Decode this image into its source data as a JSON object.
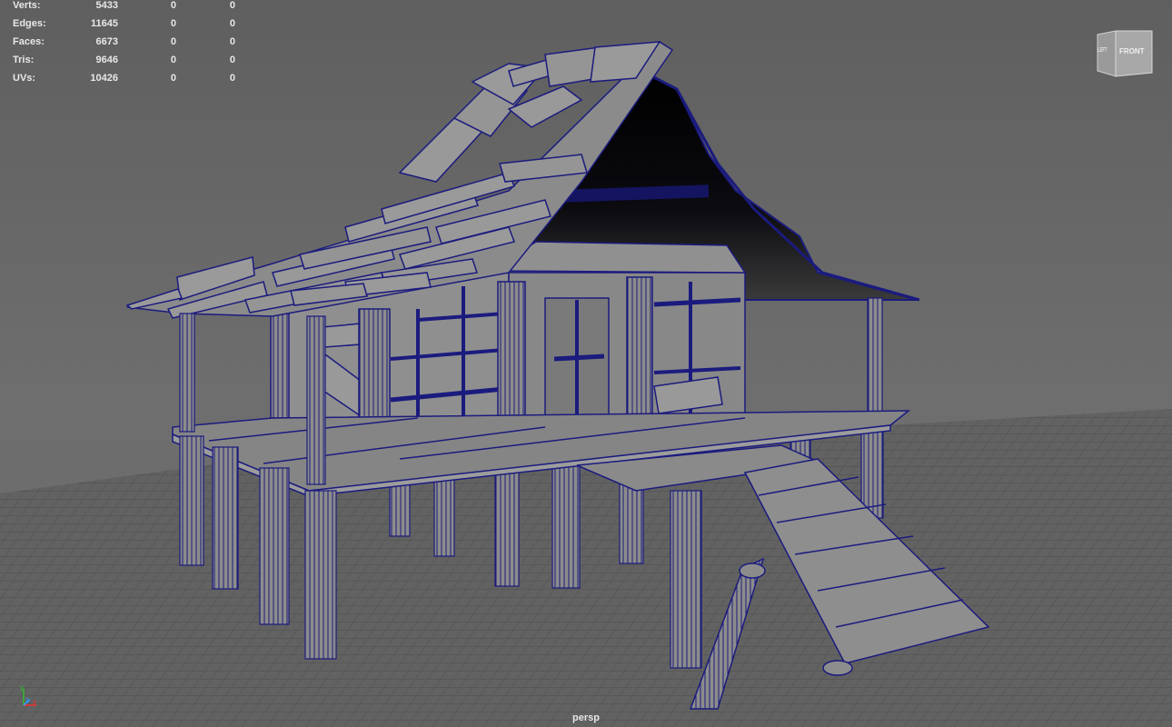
{
  "hud": {
    "rows": [
      {
        "label": "Verts:",
        "v1": "5433",
        "v2": "0",
        "v3": "0"
      },
      {
        "label": "Edges:",
        "v1": "11645",
        "v2": "0",
        "v3": "0"
      },
      {
        "label": "Faces:",
        "v1": "6673",
        "v2": "0",
        "v3": "0"
      },
      {
        "label": "Tris:",
        "v1": "9646",
        "v2": "0",
        "v3": "0"
      },
      {
        "label": "UVs:",
        "v1": "10426",
        "v2": "0",
        "v3": "0"
      }
    ]
  },
  "viewcube": {
    "front_label": "FRONT",
    "left_label": "LEFT"
  },
  "camera": {
    "name": "persp"
  },
  "axis": {
    "x": "x",
    "y": "y",
    "z": "z"
  },
  "colors": {
    "background": "#6a6a6a",
    "wire": "#1a1a8c",
    "surface": "#8a8a8a",
    "grid": "#4a4a4a",
    "hud_text": "#e8e8e8"
  }
}
